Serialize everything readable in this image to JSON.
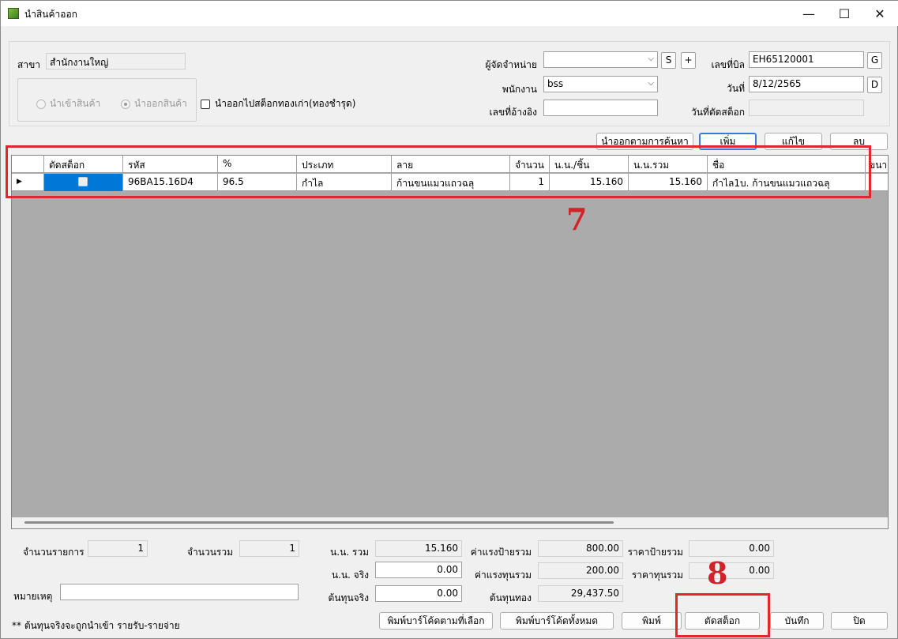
{
  "window": {
    "title": "นำสินค้าออก",
    "minimize": "—",
    "maximize": "☐",
    "close": "✕"
  },
  "header": {
    "branch_label": "สาขา",
    "branch_value": "สำนักงานใหญ่",
    "radio_in": "นำเข้าสินค้า",
    "radio_out": "นำออกสินค้า",
    "old_stock_check": "นำออกไปสต็อกทองเก่า(ทองชำรุด)",
    "supplier_label": "ผู้จัดจำหน่าย",
    "supplier_value": "",
    "supplier_btn_s": "S",
    "supplier_btn_add": "+",
    "employee_label": "พนักงาน",
    "employee_value": "bss",
    "ref_label": "เลขที่อ้างอิง",
    "ref_value": "",
    "bill_label": "เลขที่บิล",
    "bill_value": "EH65120001",
    "bill_btn": "G",
    "date_label": "วันที่",
    "date_value": "8/12/2565",
    "date_btn": "D",
    "cut_date_label": "วันที่ตัดสต็อก",
    "cut_date_value": ""
  },
  "actions": {
    "search_btn": "นำออกตามการค้นหา",
    "add_btn": "เพิ่ม",
    "edit_btn": "แก้ไข",
    "delete_btn": "ลบ"
  },
  "grid": {
    "columns": [
      "ตัดสต็อก",
      "รหัส",
      "%",
      "ประเภท",
      "ลาย",
      "จำนวน",
      "น.น./ชิ้น",
      "น.น.รวม",
      "ชื่อ",
      "ขนา"
    ],
    "rows": [
      {
        "code": "96BA15.16D4",
        "percent": "96.5",
        "type": "กำไล",
        "pattern": "ก้านขนแมวแถวฉลุ",
        "qty": "1",
        "weight_each": "15.160",
        "weight_total": "15.160",
        "name": "กำไล1บ. ก้านขนแมวแถวฉลุ"
      }
    ]
  },
  "annotations": {
    "step7": "7",
    "step8": "8",
    "color": "#e3262d"
  },
  "summary": {
    "item_count_label": "จำนวนรายการ",
    "item_count": "1",
    "total_qty_label": "จำนวนรวม",
    "total_qty": "1",
    "weight_total_label": "น.น. รวม",
    "weight_total": "15.160",
    "weight_real_label": "น.น. จริง",
    "weight_real": "0.00",
    "cost_real_label": "ต้นทุนจริง",
    "cost_real": "0.00",
    "labor_tag_label": "ค่าแรงป้ายรวม",
    "labor_tag": "800.00",
    "labor_cost_label": "ค่าแรงทุนรวม",
    "labor_cost": "200.00",
    "gold_cost_label": "ต้นทุนทอง",
    "gold_cost": "29,437.50",
    "tag_price_label": "ราคาป้ายรวม",
    "tag_price": "0.00",
    "cost_price_label": "ราคาทุนรวม",
    "cost_price": "0.00",
    "note_label": "หมายเหตุ",
    "note_value": "",
    "footnote": "** ต้นทุนจริงจะถูกนำเข้า รายรับ-รายจ่าย"
  },
  "footer": {
    "print_selected": "พิมพ์บาร์โค้ดตามที่เลือก",
    "print_all": "พิมพ์บาร์โค้ดทั้งหมด",
    "print": "พิมพ์",
    "cut_stock": "ตัดสต็อก",
    "save": "บันทึก",
    "close": "ปิด"
  }
}
